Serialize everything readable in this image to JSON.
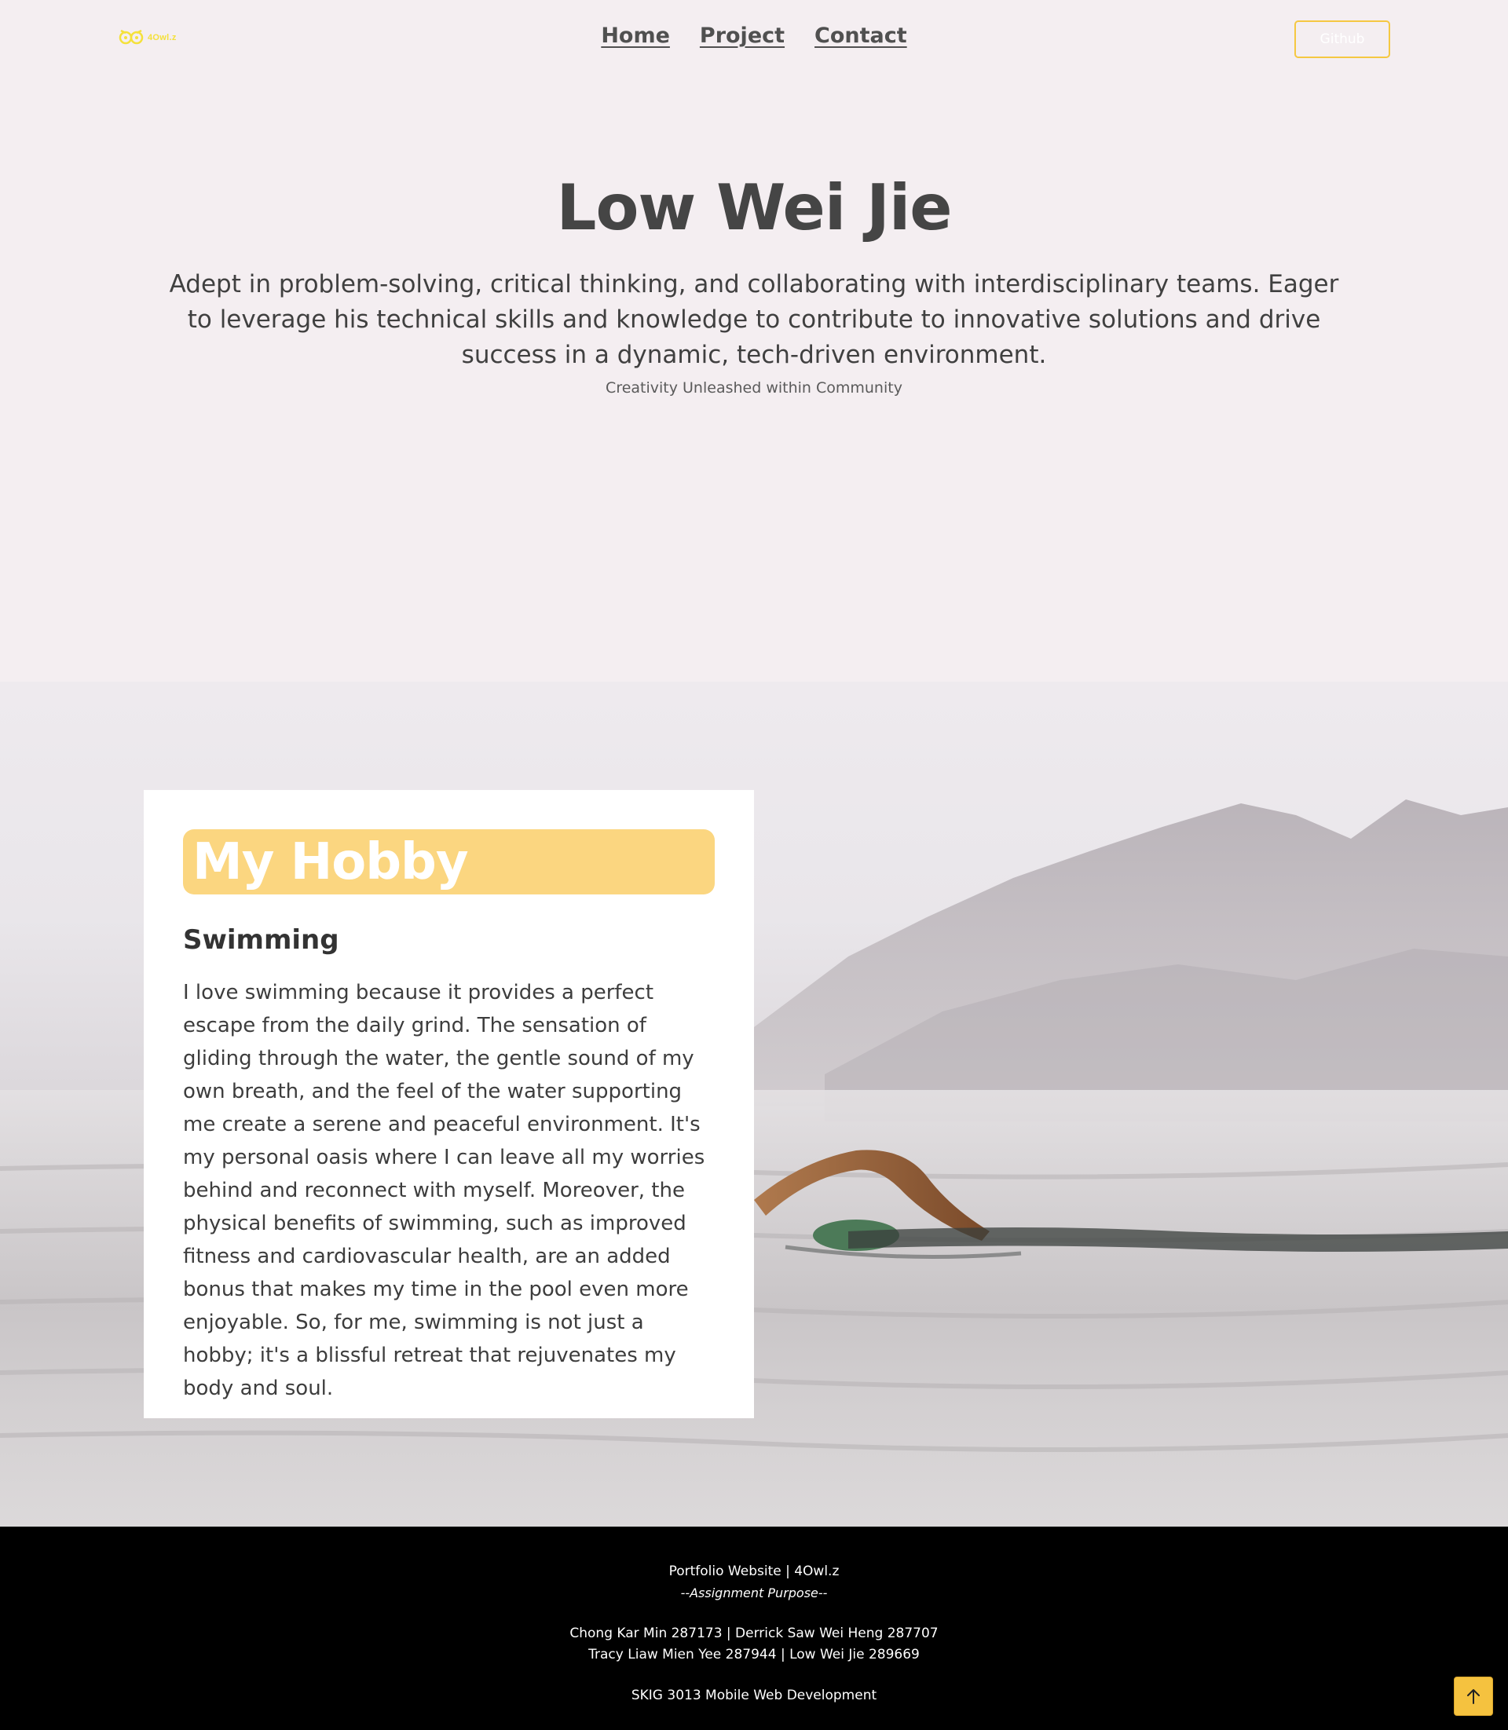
{
  "header": {
    "logo_text": "4Owl.z",
    "nav": [
      "Home",
      "Project",
      "Contact"
    ],
    "github_label": "Github"
  },
  "hero": {
    "name": "Low Wei Jie",
    "description": "Adept in problem-solving, critical thinking, and collaborating with interdisciplinary teams. Eager to leverage his technical skills and knowledge to contribute to innovative solutions and drive success in a dynamic, tech-driven environment.",
    "tagline": "Creativity Unleashed within Community"
  },
  "hobby": {
    "heading": "My Hobby",
    "subtitle": "Swimming",
    "body": "I love swimming because it provides a perfect escape from the daily grind. The sensation of gliding through the water, the gentle sound of my own breath, and the feel of the water supporting me create a serene and peaceful environment. It's my personal oasis where I can leave all my worries behind and reconnect with myself. Moreover, the physical benefits of swimming, such as improved fitness and cardiovascular health, are an added bonus that makes my time in the pool even more enjoyable. So, for me, swimming is not just a hobby; it's a blissful retreat that rejuvenates my body and soul."
  },
  "footer": {
    "title": "Portfolio Website | 4Owl.z",
    "subtitle": "--Assignment Purpose--",
    "members_line1": "Chong Kar Min 287173 | Derrick Saw Wei Heng 287707",
    "members_line2": "Tracy Liaw Mien Yee 287944 | Low Wei Jie 289669",
    "course": "SKIG 3013 Mobile Web Development"
  },
  "colors": {
    "accent": "#f5c842",
    "page_bg": "#f4eef1",
    "footer_bg": "#000000",
    "heading_badge": "#fbd680"
  },
  "icons": {
    "logo": "owl-logo-icon",
    "scroll_top": "arrow-up-icon"
  }
}
